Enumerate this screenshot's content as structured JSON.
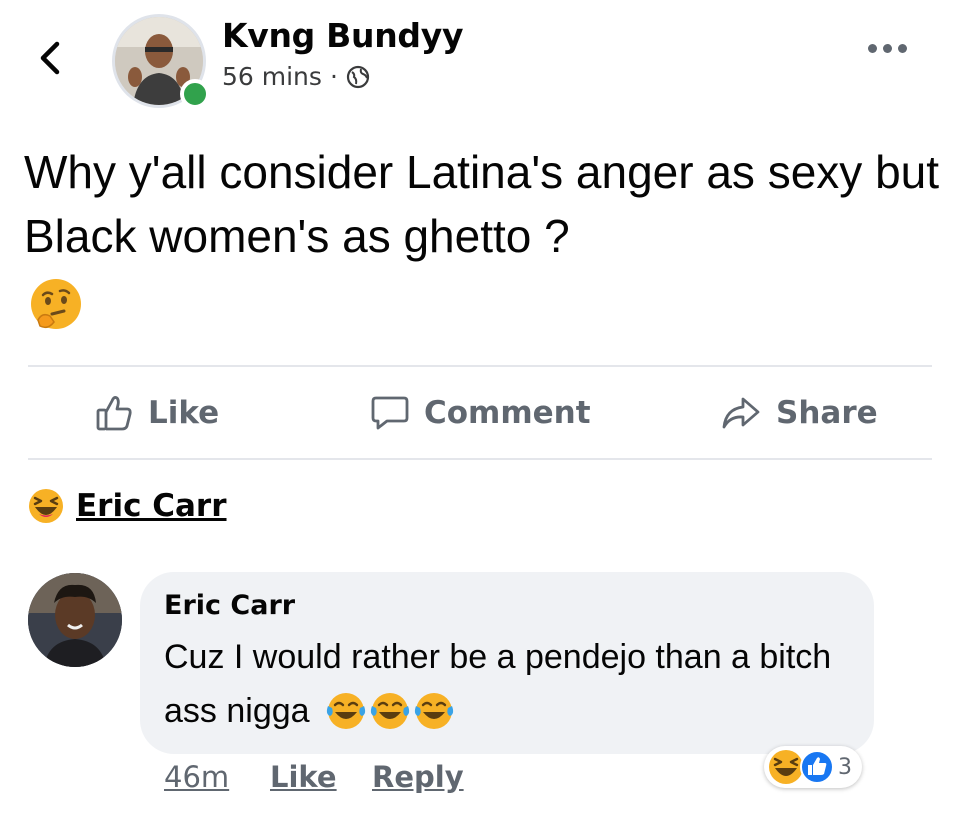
{
  "header": {
    "author_name": "Kvng Bundyy",
    "time": "56 mins",
    "separator": "·",
    "privacy_icon": "globe-icon"
  },
  "post": {
    "text": "Why y'all consider Latina's anger as sexy but Black women's as ghetto ?",
    "emoji": "thinking-face-emoji"
  },
  "actions": {
    "like_label": "Like",
    "comment_label": "Comment",
    "share_label": "Share"
  },
  "reaction_summary": {
    "icon": "laughing-face-icon",
    "name": "Eric Carr"
  },
  "comment": {
    "author": "Eric Carr",
    "text": "Cuz I would rather be a pendejo than a bitch ass nigga",
    "trailing_emojis": [
      "tears-of-joy-emoji",
      "tears-of-joy-emoji",
      "tears-of-joy-emoji"
    ],
    "time": "46m",
    "like_label": "Like",
    "reply_label": "Reply",
    "reaction_count": "3",
    "reaction_icons": [
      "laughing-face-icon",
      "thumbs-up-icon"
    ]
  },
  "colors": {
    "online": "#31a24c",
    "like_blue": "#1877f2",
    "emoji_yellow": "#f7b125",
    "secondary_text": "#606770",
    "bubble": "#f0f2f5"
  }
}
